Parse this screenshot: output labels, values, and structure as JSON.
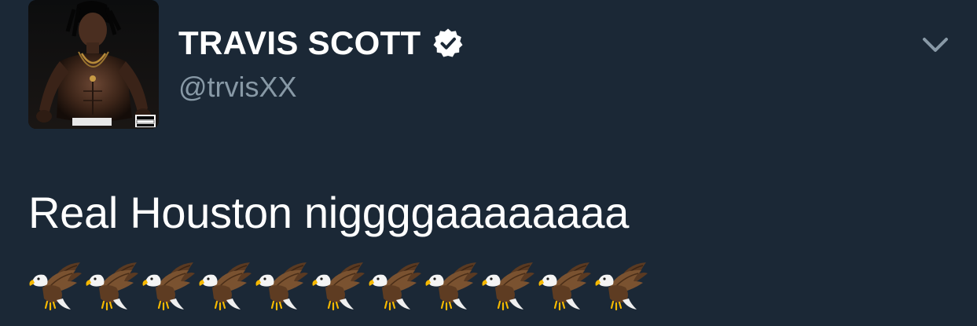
{
  "tweet": {
    "display_name": "TRAVIS SCOTT",
    "handle": "@trvisXX",
    "verified": true,
    "text": "Real Houston niggggaaaaaaaa",
    "emoji": {
      "name": "eagle",
      "count": 11
    },
    "avatar": {
      "label": "PARENTAL ADVISORY EXPLICIT CONTENT"
    }
  },
  "icons": {
    "verified": "verified-badge-icon",
    "menu": "chevron-down-icon"
  },
  "colors": {
    "background": "#1b2836",
    "name": "#ffffff",
    "handle": "#8899a6",
    "chevron": "#8899a6"
  }
}
